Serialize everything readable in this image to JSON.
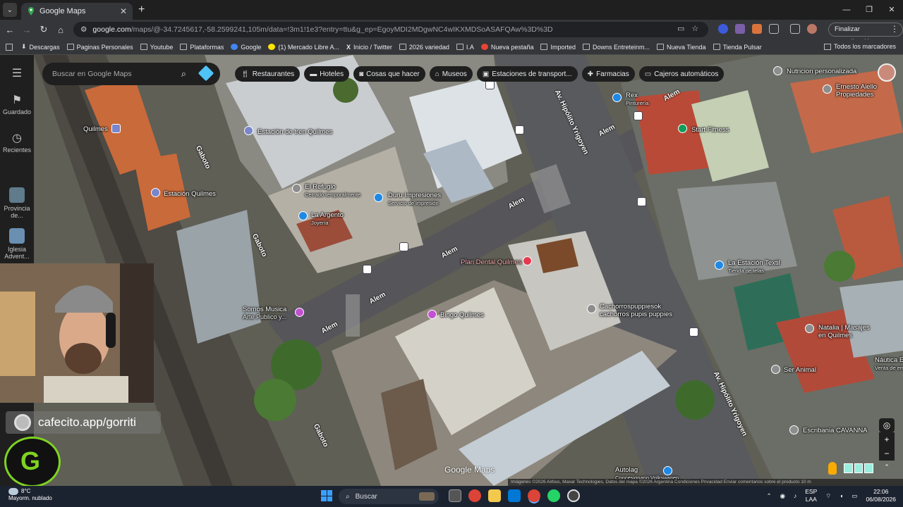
{
  "browser": {
    "tab_title": "Google Maps",
    "url_host": "google.com",
    "url_rest": "/maps/@-34.7245617,-58.2599241,105m/data=!3m1!1e3?entry=ttu&g_ep=EgoyMDI2MDgwNC4wIKXMDSoASAFQAw%3D%3D",
    "update_label": "Finalizar actualización",
    "bookmarks": [
      "Descargas",
      "Paginas Personales",
      "Youtube",
      "Plataformas",
      "Google",
      "(1) Mercado Libre A...",
      "Inicio / Twitter",
      "2026 variedad",
      "I.A",
      "Nueva pestaña",
      "Imported",
      "Downs Entreteinm...",
      "Nueva Tienda",
      "Tienda Pulsar"
    ],
    "bookmarks_all": "Todos los marcadores"
  },
  "maps": {
    "rail": {
      "saved": "Guardado",
      "recent": "Recientes",
      "item1": "Provincia de...",
      "item2": "Iglesia Advent..."
    },
    "search_placeholder": "Buscar en Google Maps",
    "chips": [
      "Restaurantes",
      "Hoteles",
      "Cosas que hacer",
      "Museos",
      "Estaciones de transport...",
      "Farmacias",
      "Cajeros automáticos"
    ],
    "places": {
      "estacion_tren": "Estación de tren Quilmes",
      "quilmes": "Quilmes",
      "estacion_quilmes": "Estación Quilmes",
      "el_refugio": "El Refugio",
      "el_refugio_sub": "Cerrado temporalmente",
      "duru": "Duru Impresiones",
      "duru_sub": "Servicio de impresión",
      "la_argento": "La Argento",
      "la_argento_sub": "Joyería",
      "plan_dental": "Plan Dental Quilmes",
      "bingo": "Bingo Quilmes",
      "somos_musica": "Somos Musica",
      "somos_musica_sub": "Arte Publico y...",
      "cachorros1": "Cachorrospuppiesok",
      "cachorros2": "cachorros pupis puppies",
      "rex": "Rex",
      "rex_sub": "Pinturería",
      "start_fitness": "Start Fitness",
      "nutricion": "Nutricion personalizada",
      "ernesto1": "Ernesto Aiello",
      "ernesto2": "Propiedades",
      "estacion_textil": "La Estación Textil",
      "estacion_textil_sub": "Tienda de telas",
      "natalia1": "Natalia | Masajes",
      "natalia2": "en Quilmes",
      "ser_animal": "Ser Animal",
      "nautica1": "Náutica E",
      "nautica2": "Venta de embar",
      "escribania": "Escribania CAVANNA",
      "autolag": "Autolag",
      "autolag_sub": "Concesionario Volkswagen"
    },
    "streets": {
      "alem": "Alem",
      "gaboto": "Gaboto",
      "yrigoyen": "Av. Hipólito Yrigoyen"
    },
    "branding": "Google Maps",
    "attribution": "Imágenes ©2026 Airbus, Maxar Technologies, Datos del mapa ©2026    Argentina    Condiciones    Privacidad    Enviar comentarios sobre el producto    10 m",
    "cafecito": "cafecito.app/gorriti"
  },
  "taskbar": {
    "weather_temp": "8°C",
    "weather_desc": "Mayorm. nublado",
    "search": "Buscar",
    "lang1": "ESP",
    "lang2": "LAA",
    "time": "22:06",
    "date": "06/08/2026"
  },
  "colors": {
    "map_bg": "#6b6b5f",
    "chip_bg": "#1f1f1f",
    "accent_blue": "#4fc3f7"
  }
}
